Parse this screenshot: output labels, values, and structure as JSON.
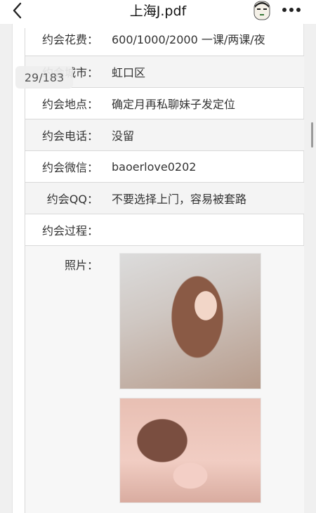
{
  "header": {
    "title": "上海J.pdf"
  },
  "viewer": {
    "page_indicator": "29/183"
  },
  "table": {
    "rows": [
      {
        "label": "约会花费：",
        "value": "600/1000/2000 一课/两课/夜"
      },
      {
        "label": "约会城市：",
        "value": "虹口区"
      },
      {
        "label": "约会地点：",
        "value": "确定月再私聊妹子发定位"
      },
      {
        "label": "约会电话：",
        "value": "没留"
      },
      {
        "label": "约会微信：",
        "value": "baoerlove0202"
      },
      {
        "label": "约会QQ：",
        "value": "不要选择上门，容易被套路"
      },
      {
        "label": "约会过程：",
        "value": ""
      }
    ],
    "photos_label": "照片："
  }
}
